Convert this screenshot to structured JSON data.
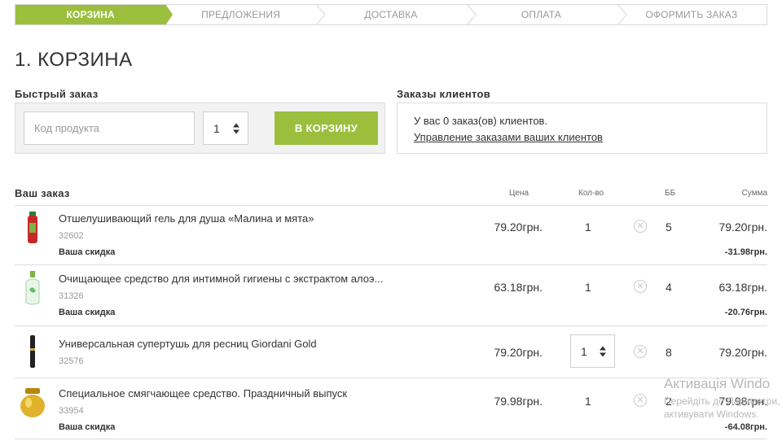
{
  "steps": [
    {
      "label": "КОРЗИНА",
      "active": true
    },
    {
      "label": "ПРЕДЛОЖЕНИЯ",
      "active": false
    },
    {
      "label": "ДОСТАВКА",
      "active": false
    },
    {
      "label": "ОПЛАТА",
      "active": false
    },
    {
      "label": "ОФОРМИТЬ ЗАКАЗ",
      "active": false
    }
  ],
  "page_title": "1. КОРЗИНА",
  "quick_order": {
    "title": "Быстрый заказ",
    "code_placeholder": "Код продукта",
    "qty": "1",
    "button_label": "В КОРЗИНУ"
  },
  "client_orders": {
    "title": "Заказы клиентов",
    "text": "У вас 0 заказ(ов) клиентов.",
    "link": "Управление заказами ваших клиентов"
  },
  "order": {
    "title": "Ваш заказ",
    "columns": {
      "price": "Цена",
      "qty": "Кол-во",
      "bb": "ББ",
      "sum": "Сумма"
    },
    "items": [
      {
        "name": "Отшелушивающий гель для душа «Малина и мята»",
        "code": "32602",
        "price": "79.20грн.",
        "qty": "1",
        "bb": "5",
        "sum": "79.20грн.",
        "discount_label": "Ваша скидка",
        "discount": "-31.98грн.",
        "thumb": "red-bottle-icon"
      },
      {
        "name": "Очищающее средство для интимной гигиены с экстрактом алоэ...",
        "code": "31326",
        "price": "63.18грн.",
        "qty": "1",
        "bb": "4",
        "sum": "63.18грн.",
        "discount_label": "Ваша скидка",
        "discount": "-20.76грн.",
        "thumb": "green-bottle-icon"
      },
      {
        "name": "Универсальная супертушь для ресниц Giordani Gold",
        "code": "32576",
        "price": "79.20грн.",
        "qty": "1",
        "bb": "8",
        "sum": "79.20грн.",
        "discount_label": "",
        "discount": "",
        "thumb": "mascara-icon"
      },
      {
        "name": "Специальное смягчающее средство. Праздничный выпуск",
        "code": "33954",
        "price": "79.98грн.",
        "qty": "1",
        "bb": "2",
        "sum": "79.98грн.",
        "discount_label": "Ваша скидка",
        "discount": "-64.08грн.",
        "thumb": "gold-jar-icon"
      }
    ]
  },
  "watermark": {
    "line1": "Активація Windo",
    "line2": "Перейдіть до Параметри, щоб",
    "line3": "активувати Windows."
  },
  "colors": {
    "accent": "#9bbf3d",
    "border": "#dcdcdc",
    "muted": "#999999"
  }
}
